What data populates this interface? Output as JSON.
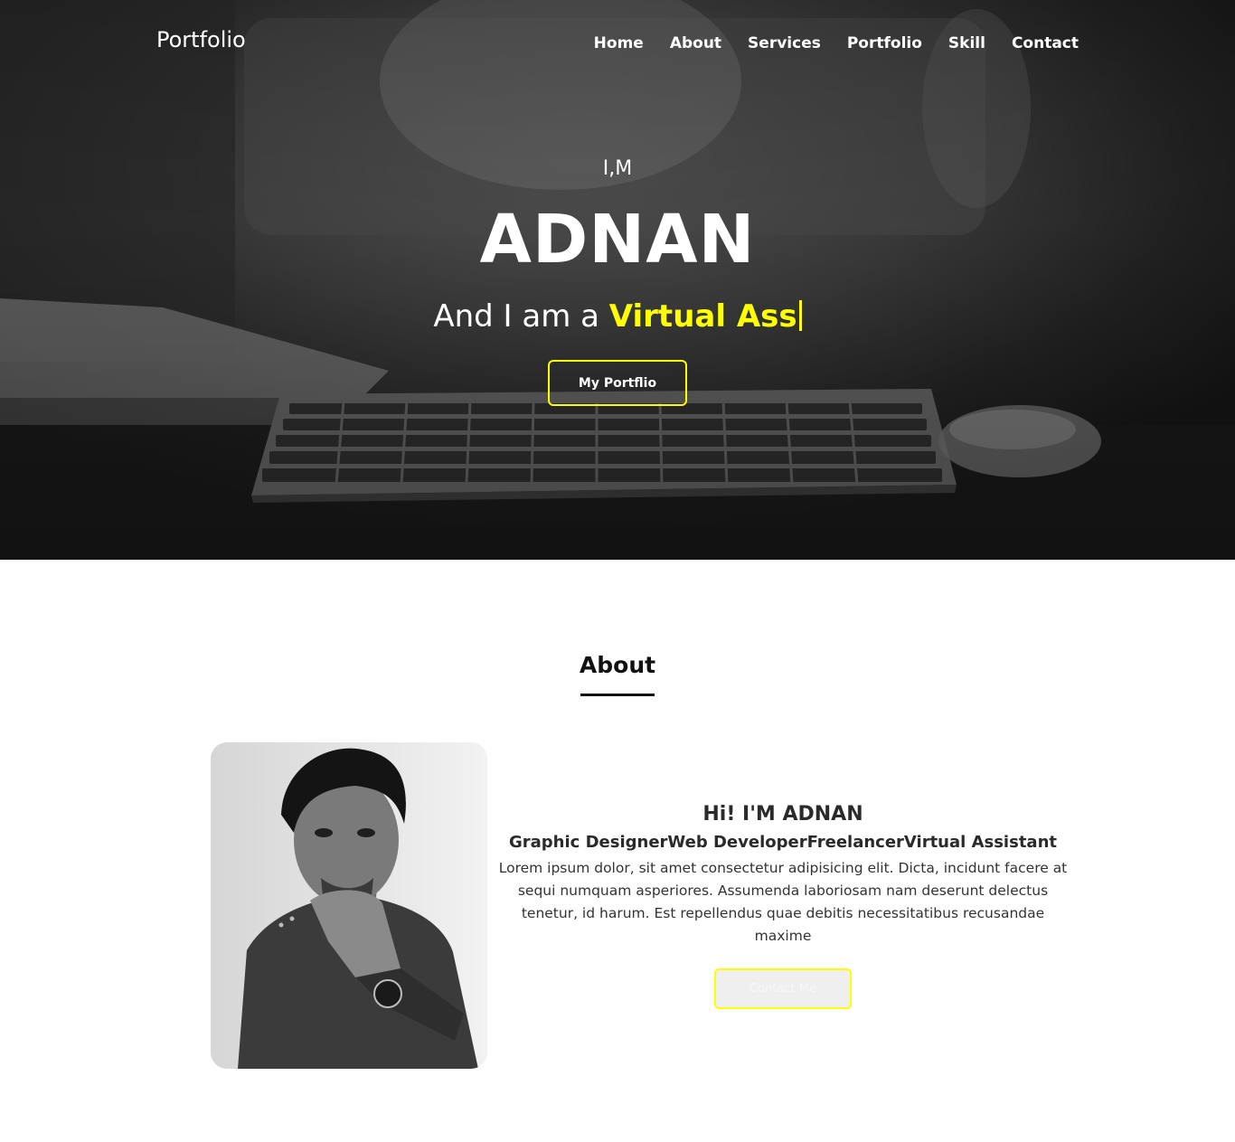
{
  "header": {
    "brand": "Portfolio",
    "nav": [
      "Home",
      "About",
      "Services",
      "Portfolio",
      "Skill",
      "Contact"
    ]
  },
  "hero": {
    "intro": "I,M",
    "name": "ADNAN",
    "typed_prefix": "And I am a ",
    "typed_highlight": "Virtual Ass",
    "button_label": "My Portflio"
  },
  "about": {
    "title": "About",
    "greeting": "Hi! I'M ADNAN",
    "roles": "Graphic DesignerWeb DeveloperFreelancerVirtual Assistant",
    "description": "Lorem ipsum dolor, sit amet consectetur adipisicing elit. Dicta, incidunt facere at sequi numquam asperiores. Assumenda laboriosam nam deserunt delectus tenetur, id harum. Est repellendus quae debitis necessitatibus recusandae maxime",
    "contact_button": "Contact Me"
  },
  "colors": {
    "accent": "#ffff00",
    "text_dark": "#222222"
  }
}
